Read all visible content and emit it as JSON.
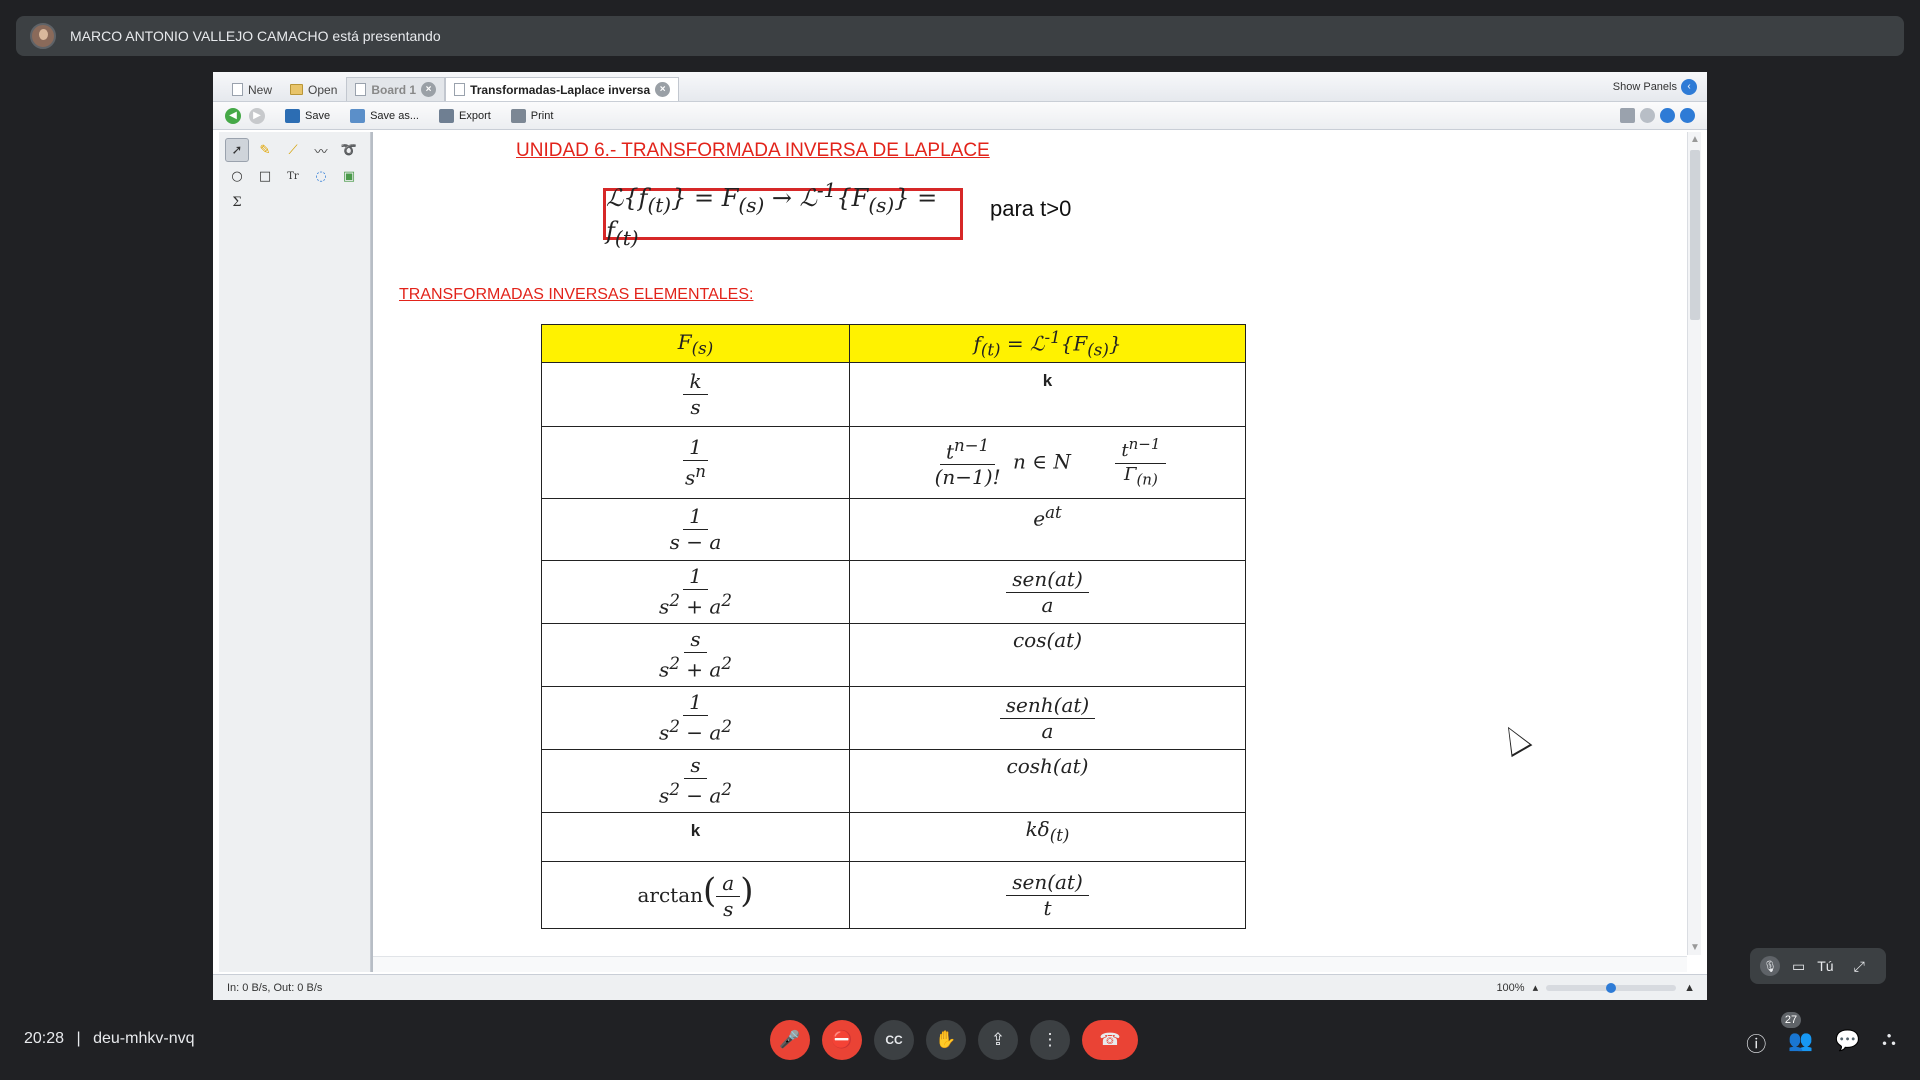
{
  "presenter": {
    "text": "MARCO ANTONIO VALLEJO CAMACHO está presentando"
  },
  "app": {
    "tabs": {
      "new": "New",
      "open": "Open",
      "board": "Board 1",
      "active": "Transformadas-Laplace inversa"
    },
    "show_panels": "Show Panels",
    "toolbar": {
      "save": "Save",
      "save_as": "Save as...",
      "export": "Export",
      "print": "Print"
    },
    "status": "In: 0 B/s, Out: 0 B/s",
    "zoom": "100%",
    "zoom_level": 0.5
  },
  "document": {
    "heading": "UNIDAD 6.- TRANSFORMADA INVERSA DE LAPLACE",
    "condition": "para t>0",
    "subheading": "TRANSFORMADAS INVERSAS ELEMENTALES:"
  },
  "meeting": {
    "time": "20:28",
    "separator": "|",
    "code": "deu-mhkv-nvq",
    "participants": "27",
    "self_label": "Tú"
  },
  "colors": {
    "accent_red": "#e2231a",
    "table_header": "#fff200",
    "hangup": "#ea4335"
  },
  "icons": [
    "mic-off-icon",
    "camera-off-icon",
    "captions-icon",
    "raise-hand-icon",
    "present-icon",
    "more-icon",
    "hangup-icon",
    "info-icon",
    "people-icon",
    "chat-icon",
    "activities-icon"
  ]
}
